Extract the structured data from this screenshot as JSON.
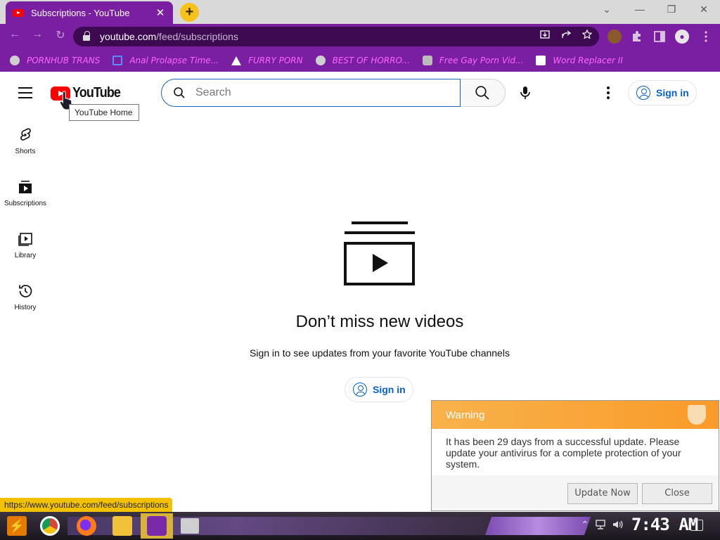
{
  "browser": {
    "tab_title": "Subscriptions - YouTube",
    "tab_close": "✕",
    "new_tab": "+",
    "window_controls": [
      "⌄",
      "—",
      "❐",
      "✕"
    ],
    "nav": [
      "←",
      "→",
      "↻"
    ],
    "url_host": "youtube.com",
    "url_path": "/feed/subscriptions",
    "omnibox_icons": [
      "install-icon",
      "share-icon",
      "star-icon"
    ],
    "bookmarks": [
      {
        "label": "PORNHUB TRANS",
        "icon": "globe-icon"
      },
      {
        "label": "Anal Prolapse Time...",
        "icon": "bracket-icon"
      },
      {
        "label": "FURRY PORN",
        "icon": "a-logo-icon"
      },
      {
        "label": "BEST OF HORRO...",
        "icon": "globe-icon"
      },
      {
        "label": "Free Gay Porn Vid...",
        "icon": "hand-icon"
      },
      {
        "label": "Word Replacer II",
        "icon": "wr-icon"
      }
    ],
    "status_url": "https://www.youtube.com/feed/subscriptions"
  },
  "youtube": {
    "logo_text": "YouTube",
    "logo_tooltip": "YouTube Home",
    "search_placeholder": "Search",
    "sign_in": "Sign in",
    "guide": [
      {
        "label": "Shorts",
        "icon": "shorts-icon"
      },
      {
        "label": "Subscriptions",
        "icon": "subscriptions-icon"
      },
      {
        "label": "Library",
        "icon": "library-icon"
      },
      {
        "label": "History",
        "icon": "history-icon"
      }
    ],
    "empty_title": "Don’t miss new videos",
    "empty_subtitle": "Sign in to see updates from your favorite YouTube channels",
    "empty_sign_in": "Sign in",
    "accent_color": "#065fd4",
    "brand_color": "#ff0000"
  },
  "warning": {
    "title": "Warning",
    "message": "It has been 29 days from a successful update. Please update your antivirus for a complete protection of your system.",
    "update_button": "Update Now",
    "close_button": "Close"
  },
  "taskbar": {
    "clock": "7:43 AM"
  }
}
